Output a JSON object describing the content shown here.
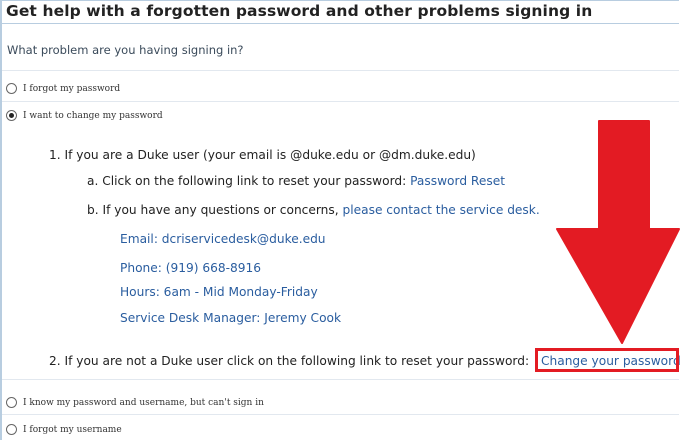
{
  "header": {
    "title": "Get help with a forgotten password and other problems signing in"
  },
  "question": "What problem are you having signing in?",
  "options": [
    {
      "label": "I forgot my password",
      "checked": false
    },
    {
      "label": "I want to change my password",
      "checked": true
    },
    {
      "label": "I know my password and username, but can't sign in",
      "checked": false
    },
    {
      "label": "I forgot my username",
      "checked": false
    }
  ],
  "duke_section": {
    "item1": "1. If you are a Duke user (your email is @duke.edu or @dm.duke.edu)",
    "item_a_text": "a. Click on the following link to reset your password:",
    "item_a_link": "Password Reset",
    "item_b_text": "b.  If you have any questions or concerns,",
    "item_b_link": "please contact the service desk.",
    "email_label": "Email:",
    "email_value": "dcriservicedesk@duke.edu",
    "phone": "Phone: (919) 668-8916",
    "hours": "Hours: 6am - Mid Monday-Friday",
    "manager": "Service Desk Manager: Jeremy Cook"
  },
  "non_duke_section": {
    "item2_text": "2. If you are not a Duke user click on the following link to reset your password:",
    "item2_link": "Change your password"
  },
  "colors": {
    "link": "#2a5d9f",
    "annotation_red": "#e31b23"
  }
}
